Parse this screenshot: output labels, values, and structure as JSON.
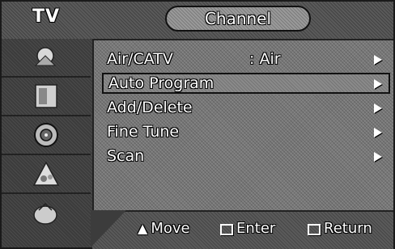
{
  "header": {
    "source_label": "TV",
    "menu_title": "Channel"
  },
  "sidebar": {
    "icons": [
      "picture-icon",
      "sound-icon",
      "channel-icon",
      "setup-icon",
      "input-icon"
    ]
  },
  "menu": {
    "items": [
      {
        "label": "Air/CATV",
        "value": ": Air",
        "selected": false
      },
      {
        "label": "Auto Program",
        "value": "",
        "selected": true
      },
      {
        "label": "Add/Delete",
        "value": "",
        "selected": false
      },
      {
        "label": "Fine Tune",
        "value": "",
        "selected": false
      },
      {
        "label": "Scan",
        "value": "",
        "selected": false
      }
    ]
  },
  "footer": {
    "move_label": "Move",
    "enter_label": "Enter",
    "return_label": "Return"
  }
}
